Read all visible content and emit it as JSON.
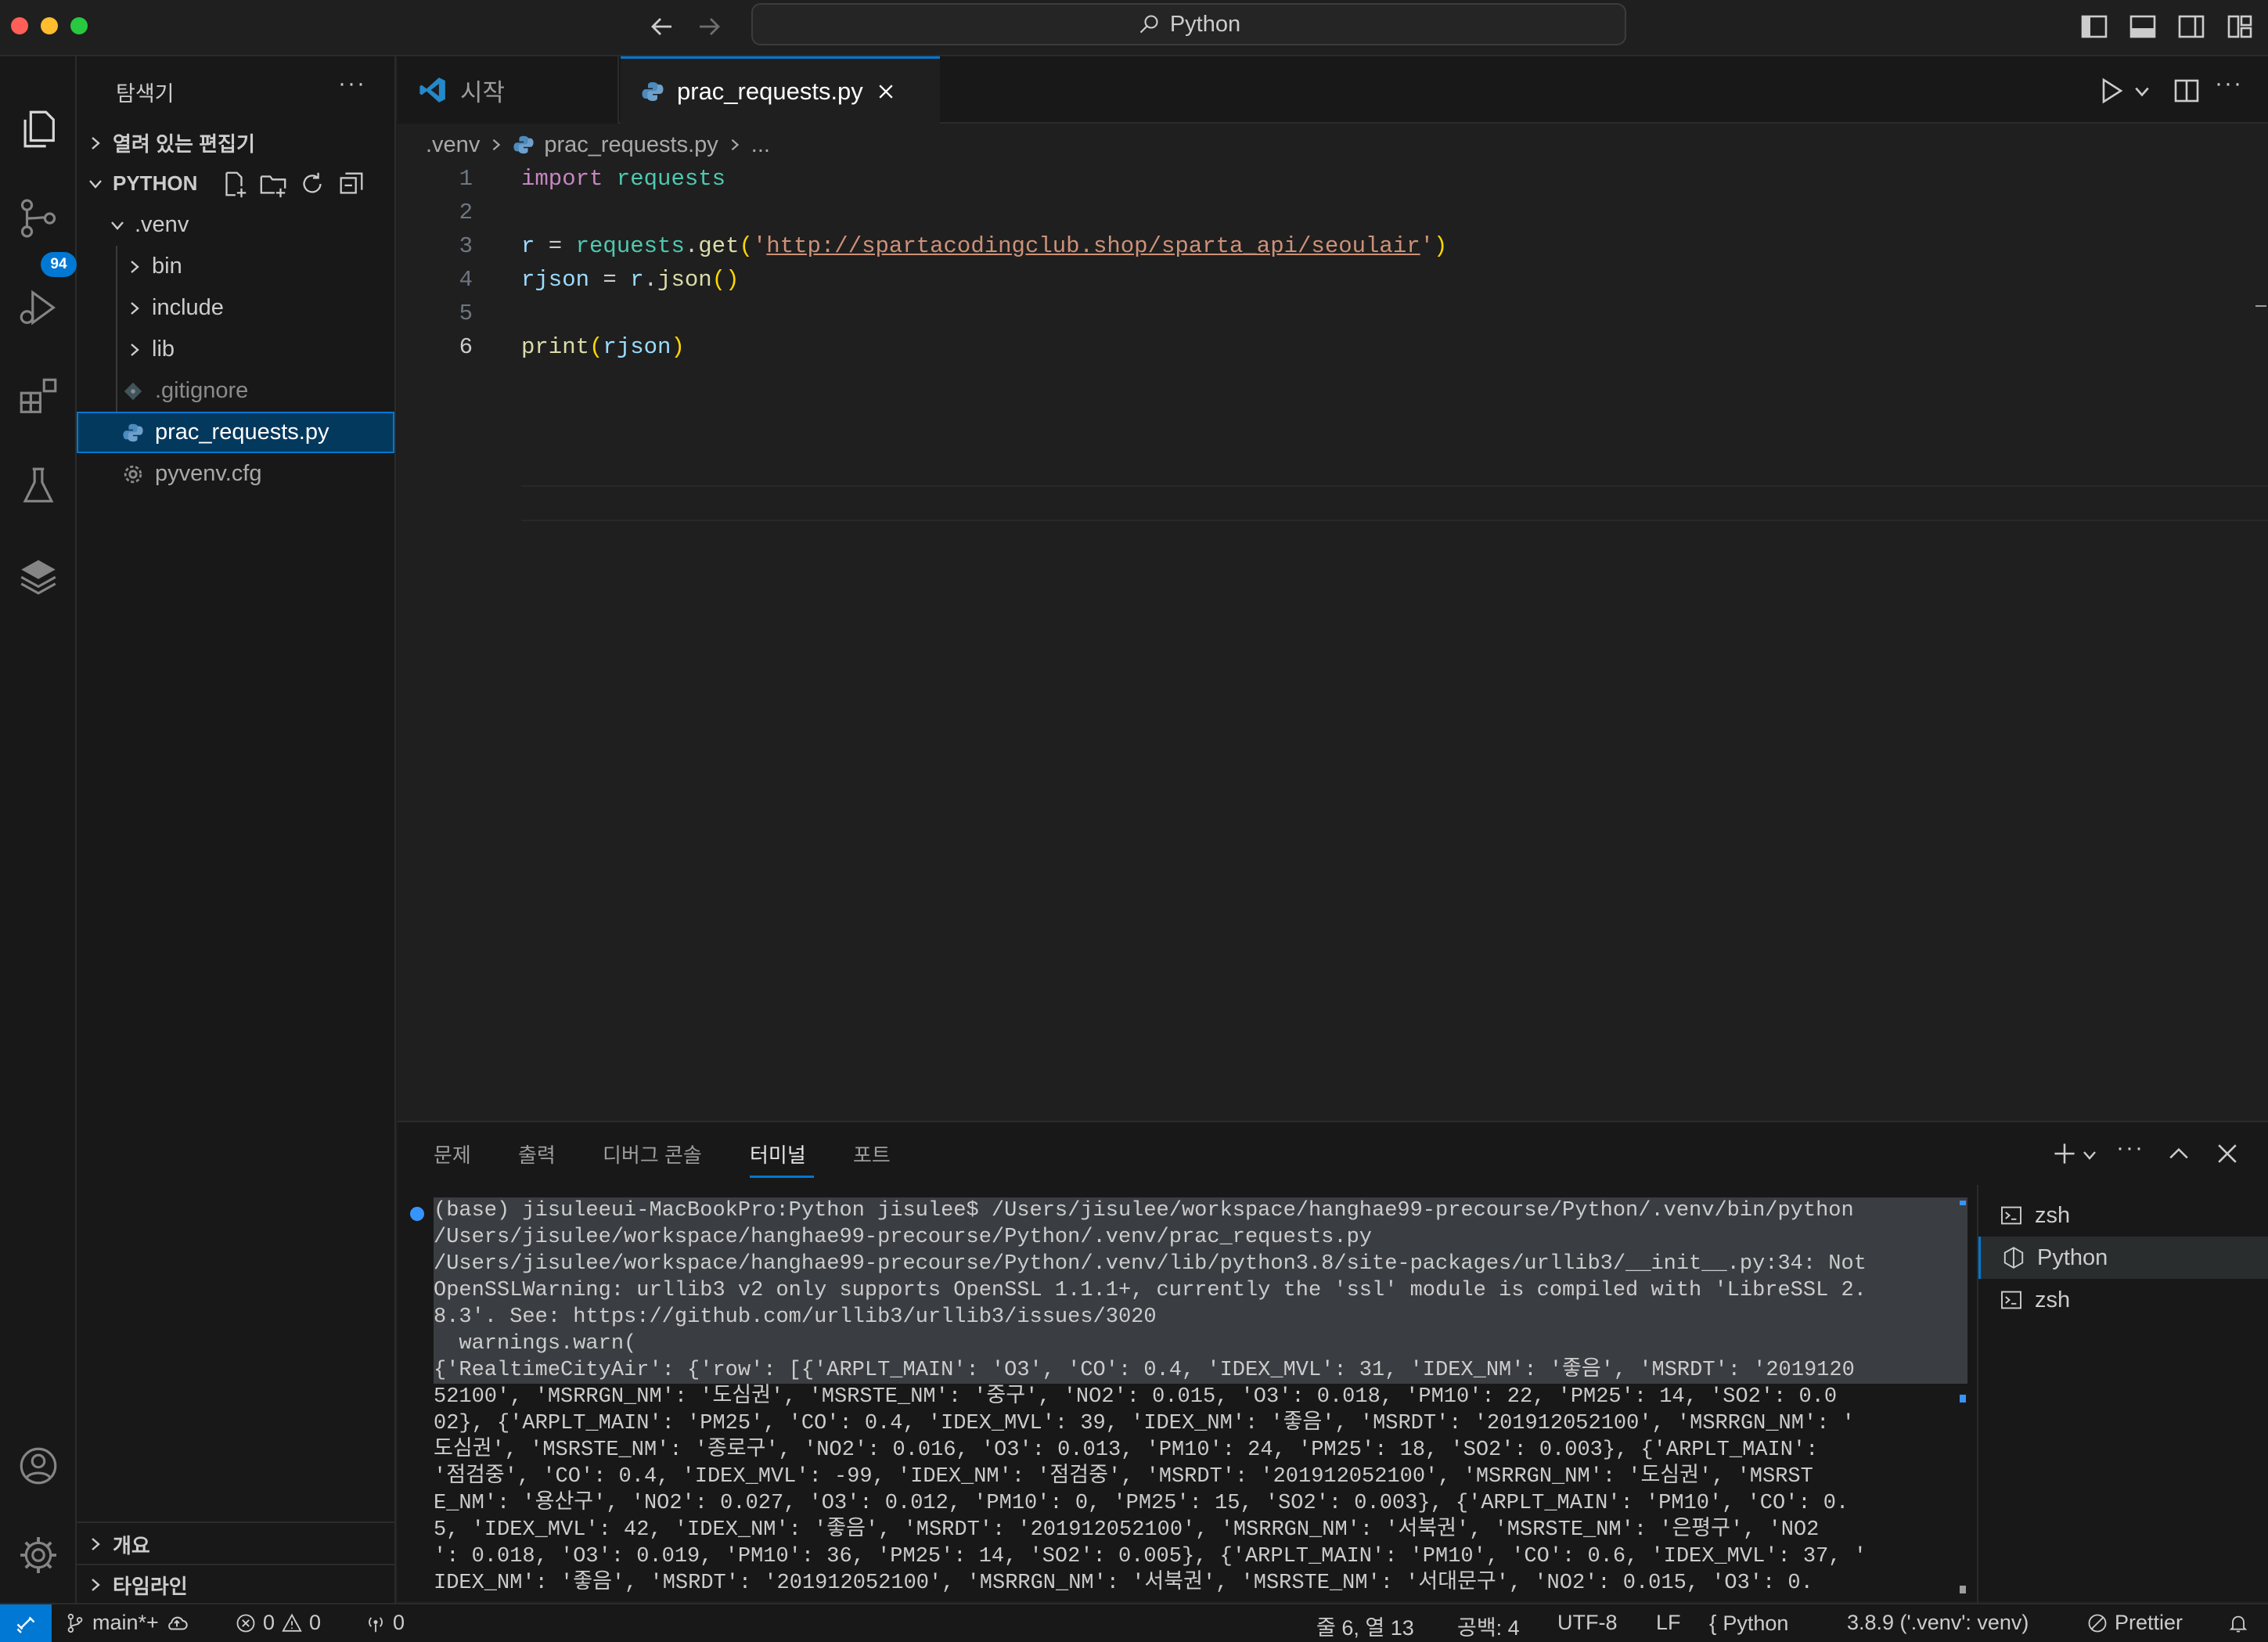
{
  "window": {
    "search_text": "Python"
  },
  "activity": {
    "scm_badge": "94"
  },
  "sidebar": {
    "title": "탐색기",
    "more": "···",
    "open_editors": "열려 있는 편집기",
    "folder": "PYTHON",
    "venv": ".venv",
    "items": [
      "bin",
      "include",
      "lib",
      ".gitignore",
      "prac_requests.py",
      "pyvenv.cfg"
    ],
    "outline": "개요",
    "timeline": "타임라인"
  },
  "tabs": {
    "start": "시작",
    "active": "prac_requests.py"
  },
  "breadcrumb": {
    "folder": ".venv",
    "file": "prac_requests.py",
    "more": "..."
  },
  "code": {
    "line_numbers": [
      "1",
      "2",
      "3",
      "4",
      "5",
      "6"
    ],
    "l1_kw": "import",
    "l1_mod": "requests",
    "l3_var": "r",
    "l3_eq": " = ",
    "l3_mod": "requests",
    "l3_dot": ".",
    "l3_fn": "get",
    "l3_open": "(",
    "l3_q1": "'",
    "l3_url": "http://spartacodingclub.shop/sparta_api/seoulair",
    "l3_q2": "'",
    "l3_close": ")",
    "l4_var": "rjson",
    "l4_eq": " = ",
    "l4_var2": "r",
    "l4_dot": ".",
    "l4_fn": "json",
    "l4_paren": "()",
    "l6_fn": "print",
    "l6_open": "(",
    "l6_var": "rjson",
    "l6_close": ")"
  },
  "panel": {
    "tabs": [
      "문제",
      "출력",
      "디버그 콘솔",
      "터미널",
      "포트"
    ],
    "terminal_lines": [
      "(base) jisuleeui-MacBookPro:Python jisulee$ /Users/jisulee/workspace/hanghae99-precourse/Python/.venv/bin/python",
      "/Users/jisulee/workspace/hanghae99-precourse/Python/.venv/prac_requests.py",
      "/Users/jisulee/workspace/hanghae99-precourse/Python/.venv/lib/python3.8/site-packages/urllib3/__init__.py:34: Not",
      "OpenSSLWarning: urllib3 v2 only supports OpenSSL 1.1.1+, currently the 'ssl' module is compiled with 'LibreSSL 2.",
      "8.3'. See: https://github.com/urllib3/urllib3/issues/3020",
      "  warnings.warn(",
      "{'RealtimeCityAir': {'row': [{'ARPLT_MAIN': 'O3', 'CO': 0.4, 'IDEX_MVL': 31, 'IDEX_NM': '좋음', 'MSRDT': '2019120",
      "52100', 'MSRRGN_NM': '도심권', 'MSRSTE_NM': '중구', 'NO2': 0.015, 'O3': 0.018, 'PM10': 22, 'PM25': 14, 'SO2': 0.0",
      "02}, {'ARPLT_MAIN': 'PM25', 'CO': 0.4, 'IDEX_MVL': 39, 'IDEX_NM': '좋음', 'MSRDT': '201912052100', 'MSRRGN_NM': '",
      "도심권', 'MSRSTE_NM': '종로구', 'NO2': 0.016, 'O3': 0.013, 'PM10': 24, 'PM25': 18, 'SO2': 0.003}, {'ARPLT_MAIN':",
      "'점검중', 'CO': 0.4, 'IDEX_MVL': -99, 'IDEX_NM': '점검중', 'MSRDT': '201912052100', 'MSRRGN_NM': '도심권', 'MSRST",
      "E_NM': '용산구', 'NO2': 0.027, 'O3': 0.012, 'PM10': 0, 'PM25': 15, 'SO2': 0.003}, {'ARPLT_MAIN': 'PM10', 'CO': 0.",
      "5, 'IDEX_MVL': 42, 'IDEX_NM': '좋음', 'MSRDT': '201912052100', 'MSRRGN_NM': '서북권', 'MSRSTE_NM': '은평구', 'NO2",
      "': 0.018, 'O3': 0.019, 'PM10': 36, 'PM25': 14, 'SO2': 0.005}, {'ARPLT_MAIN': 'PM10', 'CO': 0.6, 'IDEX_MVL': 37, '",
      "IDEX_NM': '좋음', 'MSRDT': '201912052100', 'MSRRGN_NM': '서북권', 'MSRSTE_NM': '서대문구', 'NO2': 0.015, 'O3': 0."
    ],
    "terminals": [
      "zsh",
      "Python",
      "zsh"
    ]
  },
  "status": {
    "branch": "main*+",
    "errors": "0",
    "warnings": "0",
    "ports": "0",
    "position": "줄 6, 열 13",
    "spaces": "공백: 4",
    "encoding": "UTF-8",
    "eol": "LF",
    "language": "Python",
    "interpreter": "3.8.9 ('.venv': venv)",
    "prettier": "Prettier"
  },
  "colors": {
    "accent": "#0078d4",
    "background": "#1f1f1f",
    "sidebar": "#181818"
  }
}
